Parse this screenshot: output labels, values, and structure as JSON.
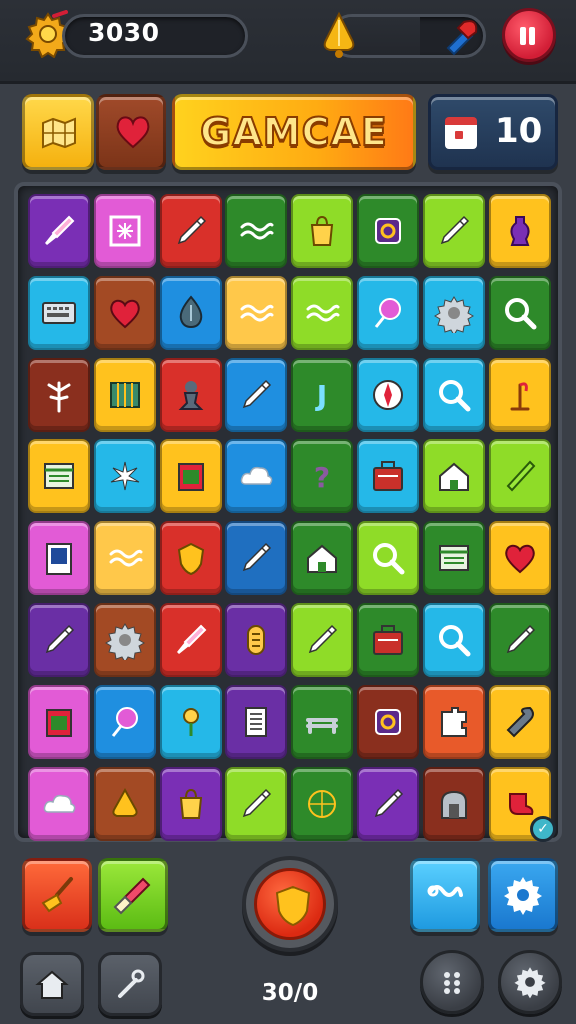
{
  "hud": {
    "score": "3030",
    "progress_fraction": 0.58,
    "icons": [
      "gear-coin-icon",
      "bell-icon",
      "rocket-icon",
      "pause-icon"
    ]
  },
  "header": {
    "title": "GAMCAE",
    "moves": "10",
    "icons": [
      "map-icon",
      "heart-icon",
      "calendar-icon"
    ]
  },
  "board": {
    "rows": 8,
    "cols": 8,
    "tiles": [
      [
        {
          "c": "#7a2fb5",
          "i": "brush"
        },
        {
          "c": "#e25bd6",
          "i": "frame"
        },
        {
          "c": "#d9302a",
          "i": "pencil"
        },
        {
          "c": "#2e8a2a",
          "i": "wave"
        },
        {
          "c": "#8fdc28",
          "i": "bag"
        },
        {
          "c": "#2e8a2a",
          "i": "ring"
        },
        {
          "c": "#8fdc28",
          "i": "pencil"
        },
        {
          "c": "#ffc21e",
          "i": "vase"
        }
      ],
      [
        {
          "c": "#25b8e8",
          "i": "keyboard"
        },
        {
          "c": "#a34a24",
          "i": "heart"
        },
        {
          "c": "#1f8fe0",
          "i": "drop"
        },
        {
          "c": "#ffc84a",
          "i": "wave"
        },
        {
          "c": "#8fdc28",
          "i": "wave"
        },
        {
          "c": "#25b8e8",
          "i": "lollipop"
        },
        {
          "c": "#25b8e8",
          "i": "gear"
        },
        {
          "c": "#2e8a2a",
          "i": "search"
        }
      ],
      [
        {
          "c": "#8a2f1e",
          "i": "tree"
        },
        {
          "c": "#ffc21e",
          "i": "grid"
        },
        {
          "c": "#d9302a",
          "i": "pawn"
        },
        {
          "c": "#1f8fe0",
          "i": "pencil"
        },
        {
          "c": "#2e8a2a",
          "i": "letter"
        },
        {
          "c": "#25b8e8",
          "i": "compass"
        },
        {
          "c": "#25b8e8",
          "i": "search"
        },
        {
          "c": "#ffc21e",
          "i": "lamp"
        }
      ],
      [
        {
          "c": "#ffc21e",
          "i": "window"
        },
        {
          "c": "#25b8e8",
          "i": "spark"
        },
        {
          "c": "#ffc21e",
          "i": "box"
        },
        {
          "c": "#1f8fe0",
          "i": "cloud"
        },
        {
          "c": "#2e8a2a",
          "i": "question"
        },
        {
          "c": "#25b8e8",
          "i": "case"
        },
        {
          "c": "#8fdc28",
          "i": "house"
        },
        {
          "c": "#8fdc28",
          "i": "cone"
        }
      ],
      [
        {
          "c": "#e25bd6",
          "i": "card"
        },
        {
          "c": "#ffc84a",
          "i": "wave"
        },
        {
          "c": "#d9302a",
          "i": "shield"
        },
        {
          "c": "#1f6fc0",
          "i": "pencil"
        },
        {
          "c": "#2e8a2a",
          "i": "house"
        },
        {
          "c": "#8fdc28",
          "i": "search"
        },
        {
          "c": "#2e8a2a",
          "i": "window"
        },
        {
          "c": "#ffc21e",
          "i": "heart"
        }
      ],
      [
        {
          "c": "#6a2fa5",
          "i": "pencil"
        },
        {
          "c": "#a34a24",
          "i": "gear"
        },
        {
          "c": "#d9302a",
          "i": "brush"
        },
        {
          "c": "#6a2fa5",
          "i": "coin"
        },
        {
          "c": "#8fdc28",
          "i": "pencil"
        },
        {
          "c": "#2e8a2a",
          "i": "case"
        },
        {
          "c": "#25b8e8",
          "i": "search"
        },
        {
          "c": "#2e8a2a",
          "i": "pencil"
        }
      ],
      [
        {
          "c": "#e25bd6",
          "i": "box"
        },
        {
          "c": "#1f8fe0",
          "i": "lollipop"
        },
        {
          "c": "#25b8e8",
          "i": "flower"
        },
        {
          "c": "#6a2fa5",
          "i": "notes"
        },
        {
          "c": "#2e8a2a",
          "i": "bench"
        },
        {
          "c": "#8a2f1e",
          "i": "ring"
        },
        {
          "c": "#e85a2a",
          "i": "puzzle"
        },
        {
          "c": "#ffc21e",
          "i": "wrench"
        }
      ],
      [
        {
          "c": "#e25bd6",
          "i": "cloud"
        },
        {
          "c": "#a34a24",
          "i": "bell"
        },
        {
          "c": "#7a2fb5",
          "i": "bag"
        },
        {
          "c": "#8fdc28",
          "i": "pencil"
        },
        {
          "c": "#2e8a2a",
          "i": "globe"
        },
        {
          "c": "#7a2fb5",
          "i": "pencil"
        },
        {
          "c": "#8a2f1e",
          "i": "arch"
        },
        {
          "c": "#ffc21e",
          "i": "sock"
        }
      ]
    ]
  },
  "bottom": {
    "level": "30/0",
    "buttons": [
      "broom-button",
      "paint-button",
      "shield-button",
      "link-button",
      "settings-button",
      "home-button",
      "key-button",
      "menu-button",
      "gear-button"
    ]
  },
  "colors": {
    "background": "#3a3f47",
    "accent": "#ffc21e",
    "danger": "#d21e36"
  }
}
